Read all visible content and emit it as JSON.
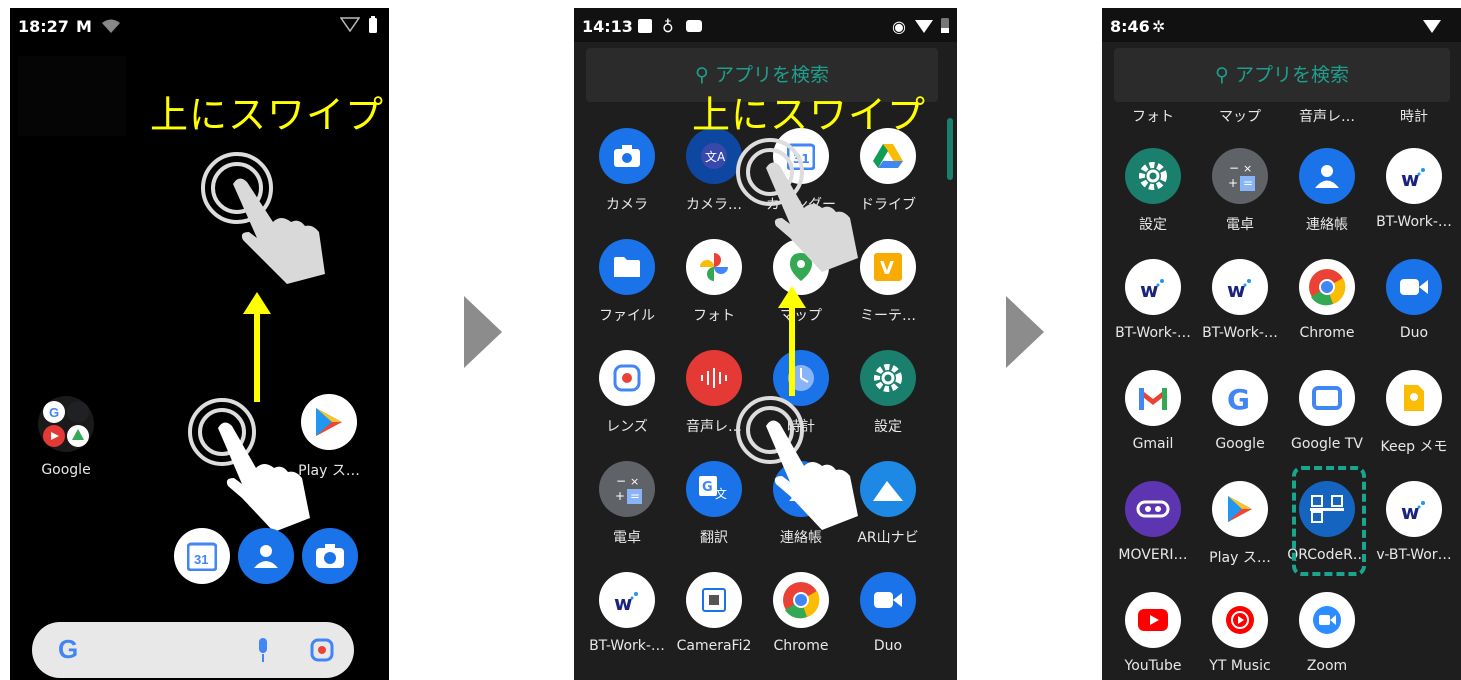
{
  "instruction": {
    "swipe_text": "上にスワイプ"
  },
  "screen1": {
    "status_time": "18:27",
    "folder_label": "Google",
    "play_label": "Play ス…"
  },
  "screen2": {
    "status_time": "14:13",
    "search_placeholder": "アプリを検索",
    "apps": [
      {
        "label": "カメラ",
        "color": "#1a73e8",
        "icon": "camera-icon"
      },
      {
        "label": "カメラ…",
        "color": "#0d47a1",
        "icon": "camera-translate-icon"
      },
      {
        "label": "カレンダー",
        "color": "#ffffff",
        "icon": "calendar-icon"
      },
      {
        "label": "ドライブ",
        "color": "#ffffff",
        "icon": "drive-icon"
      },
      {
        "label": "ファイル",
        "color": "#1a73e8",
        "icon": "files-icon"
      },
      {
        "label": "フォト",
        "color": "#ffffff",
        "icon": "photos-icon"
      },
      {
        "label": "マップ",
        "color": "#ffffff",
        "icon": "maps-icon"
      },
      {
        "label": "ミーテ…",
        "color": "#ffffff",
        "icon": "meeting-icon"
      },
      {
        "label": "レンズ",
        "color": "#ffffff",
        "icon": "lens-icon"
      },
      {
        "label": "音声レ…",
        "color": "#e53935",
        "icon": "recorder-icon"
      },
      {
        "label": "時計",
        "color": "#1a73e8",
        "icon": "clock-icon"
      },
      {
        "label": "設定",
        "color": "#1a7f6c",
        "icon": "settings-icon"
      },
      {
        "label": "電卓",
        "color": "#5f6368",
        "icon": "calculator-icon"
      },
      {
        "label": "翻訳",
        "color": "#1a73e8",
        "icon": "translate-icon"
      },
      {
        "label": "連絡帳",
        "color": "#1a73e8",
        "icon": "contacts-icon"
      },
      {
        "label": "AR山ナビ",
        "color": "#1e88e5",
        "icon": "ar-mountain-icon"
      },
      {
        "label": "BT-Work-…",
        "color": "#ffffff",
        "icon": "bt-work-icon"
      },
      {
        "label": "CameraFi2",
        "color": "#ffffff",
        "icon": "camerafi-icon"
      },
      {
        "label": "Chrome",
        "color": "#ffffff",
        "icon": "chrome-icon"
      },
      {
        "label": "Duo",
        "color": "#1a73e8",
        "icon": "duo-icon"
      }
    ]
  },
  "screen3": {
    "status_time": "8:46",
    "search_placeholder": "アプリを検索",
    "top_labels": [
      "フォト",
      "マップ",
      "音声レ…",
      "時計"
    ],
    "apps": [
      {
        "label": "設定",
        "color": "#1a7f6c",
        "icon": "settings-icon"
      },
      {
        "label": "電卓",
        "color": "#5f6368",
        "icon": "calculator-icon"
      },
      {
        "label": "連絡帳",
        "color": "#1a73e8",
        "icon": "contacts-icon"
      },
      {
        "label": "BT-Work-…",
        "color": "#ffffff",
        "icon": "bt-work-icon"
      },
      {
        "label": "BT-Work-…",
        "color": "#ffffff",
        "icon": "bt-work-icon"
      },
      {
        "label": "BT-Work-…",
        "color": "#ffffff",
        "icon": "bt-work-icon"
      },
      {
        "label": "Chrome",
        "color": "#ffffff",
        "icon": "chrome-icon"
      },
      {
        "label": "Duo",
        "color": "#1a73e8",
        "icon": "duo-icon"
      },
      {
        "label": "Gmail",
        "color": "#ffffff",
        "icon": "gmail-icon"
      },
      {
        "label": "Google",
        "color": "#ffffff",
        "icon": "google-icon"
      },
      {
        "label": "Google TV",
        "color": "#ffffff",
        "icon": "google-tv-icon"
      },
      {
        "label": "Keep メモ",
        "color": "#ffffff",
        "icon": "keep-icon"
      },
      {
        "label": "MOVERI…",
        "color": "#5e35b1",
        "icon": "moverio-icon"
      },
      {
        "label": "Play ス…",
        "color": "#ffffff",
        "icon": "play-store-icon"
      },
      {
        "label": "QRCodeR…",
        "color": "#1565c0",
        "icon": "qrcode-icon"
      },
      {
        "label": "v-BT-Wor…",
        "color": "#ffffff",
        "icon": "bt-work-icon"
      },
      {
        "label": "YouTube",
        "color": "#ffffff",
        "icon": "youtube-icon"
      },
      {
        "label": "YT Music",
        "color": "#ffffff",
        "icon": "yt-music-icon"
      },
      {
        "label": "Zoom",
        "color": "#ffffff",
        "icon": "zoom-icon"
      }
    ]
  }
}
